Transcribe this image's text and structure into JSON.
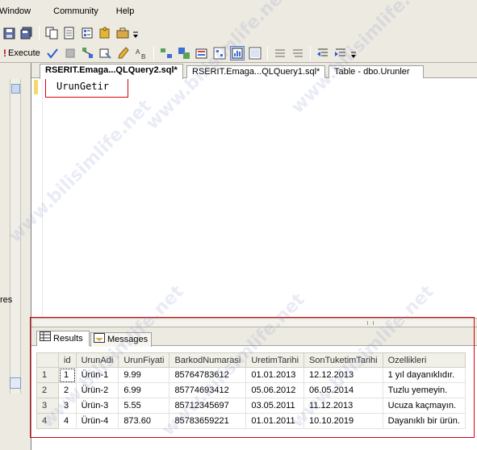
{
  "menu": {
    "items": [
      "Window",
      "Community",
      "Help"
    ]
  },
  "toolbar2": {
    "execute_label": "Execute"
  },
  "left_strip": {
    "label": "res"
  },
  "editor_tabs": [
    {
      "label": "RSERIT.Emaga...QLQuery2.sql*",
      "active": true
    },
    {
      "label": "RSERIT.Emaga...QLQuery1.sql*",
      "active": false
    },
    {
      "label": "Table - dbo.Urunler",
      "active": false
    }
  ],
  "editor": {
    "sql": "UrunGetir"
  },
  "result_tabs": [
    {
      "label": "Results",
      "active": true
    },
    {
      "label": "Messages",
      "active": false
    }
  ],
  "grid": {
    "columns": [
      "id",
      "UrunAdi",
      "UrunFiyati",
      "BarkodNumarasi",
      "UretimTarihi",
      "SonTuketimTarihi",
      "Ozellikleri"
    ],
    "rows": [
      {
        "num": "1",
        "cells": [
          "1",
          "Ürün-1",
          "9.99",
          "85764783612",
          "01.01.2013",
          "12.12.2013",
          "1 yıl dayanıklıdır."
        ]
      },
      {
        "num": "2",
        "cells": [
          "2",
          "Ürün-2",
          "6.99",
          "85774693412",
          "05.06.2012",
          "06.05.2014",
          "Tuzlu yemeyin."
        ]
      },
      {
        "num": "3",
        "cells": [
          "3",
          "Ürün-3",
          "5.55",
          "85712345697",
          "03.05.2011",
          "11.12.2013",
          "Ucuza kaçmayın."
        ]
      },
      {
        "num": "4",
        "cells": [
          "4",
          "Ürün-4",
          "873.60",
          "85783659221",
          "01.01.2011",
          "10.10.2019",
          "Dayanıklı bir ürün."
        ]
      }
    ]
  },
  "watermark": {
    "text": "www.bilisimlife.net"
  },
  "colors": {
    "highlight_red": "#d8000a",
    "chrome": "#eceae1",
    "execute_bang": "#c00000"
  }
}
